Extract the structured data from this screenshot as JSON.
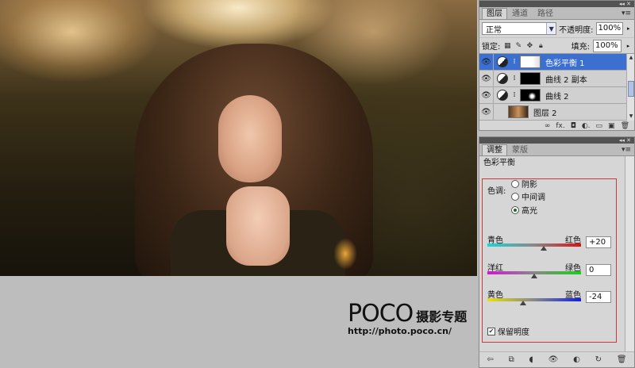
{
  "layers_panel": {
    "tabs": [
      "图层",
      "通道",
      "路径"
    ],
    "active_tab": 0,
    "blend_mode": "正常",
    "opacity_label": "不透明度:",
    "opacity_value": "100%",
    "lock_label": "锁定:",
    "fill_label": "填充:",
    "fill_value": "100%",
    "layers": [
      {
        "name": "色彩平衡 1",
        "selected": true
      },
      {
        "name": "曲线 2 副本",
        "selected": false
      },
      {
        "name": "曲线 2",
        "selected": false
      },
      {
        "name": "图层 2",
        "selected": false
      }
    ]
  },
  "adjust_panel": {
    "tabs": [
      "调整",
      "蒙版"
    ],
    "active_tab": 0,
    "title": "色彩平衡",
    "tone_label": "色调:",
    "tone_options": [
      "阴影",
      "中间调",
      "高光"
    ],
    "selected_tone": 2,
    "sliders": [
      {
        "left": "青色",
        "right": "红色",
        "value": "+20",
        "level": 0.6
      },
      {
        "left": "洋红",
        "right": "绿色",
        "value": "0",
        "level": 0.5
      },
      {
        "left": "黄色",
        "right": "蓝色",
        "value": "-24",
        "level": 0.38
      }
    ],
    "preserve_label": "保留明度",
    "preserve_checked": true
  },
  "watermark": {
    "logo": "POCO",
    "tagline": "摄影专题",
    "url": "http://photo.poco.cn/"
  },
  "colors": {
    "selection": "#3b6fd0",
    "highlight_box": "#c83a3a"
  }
}
